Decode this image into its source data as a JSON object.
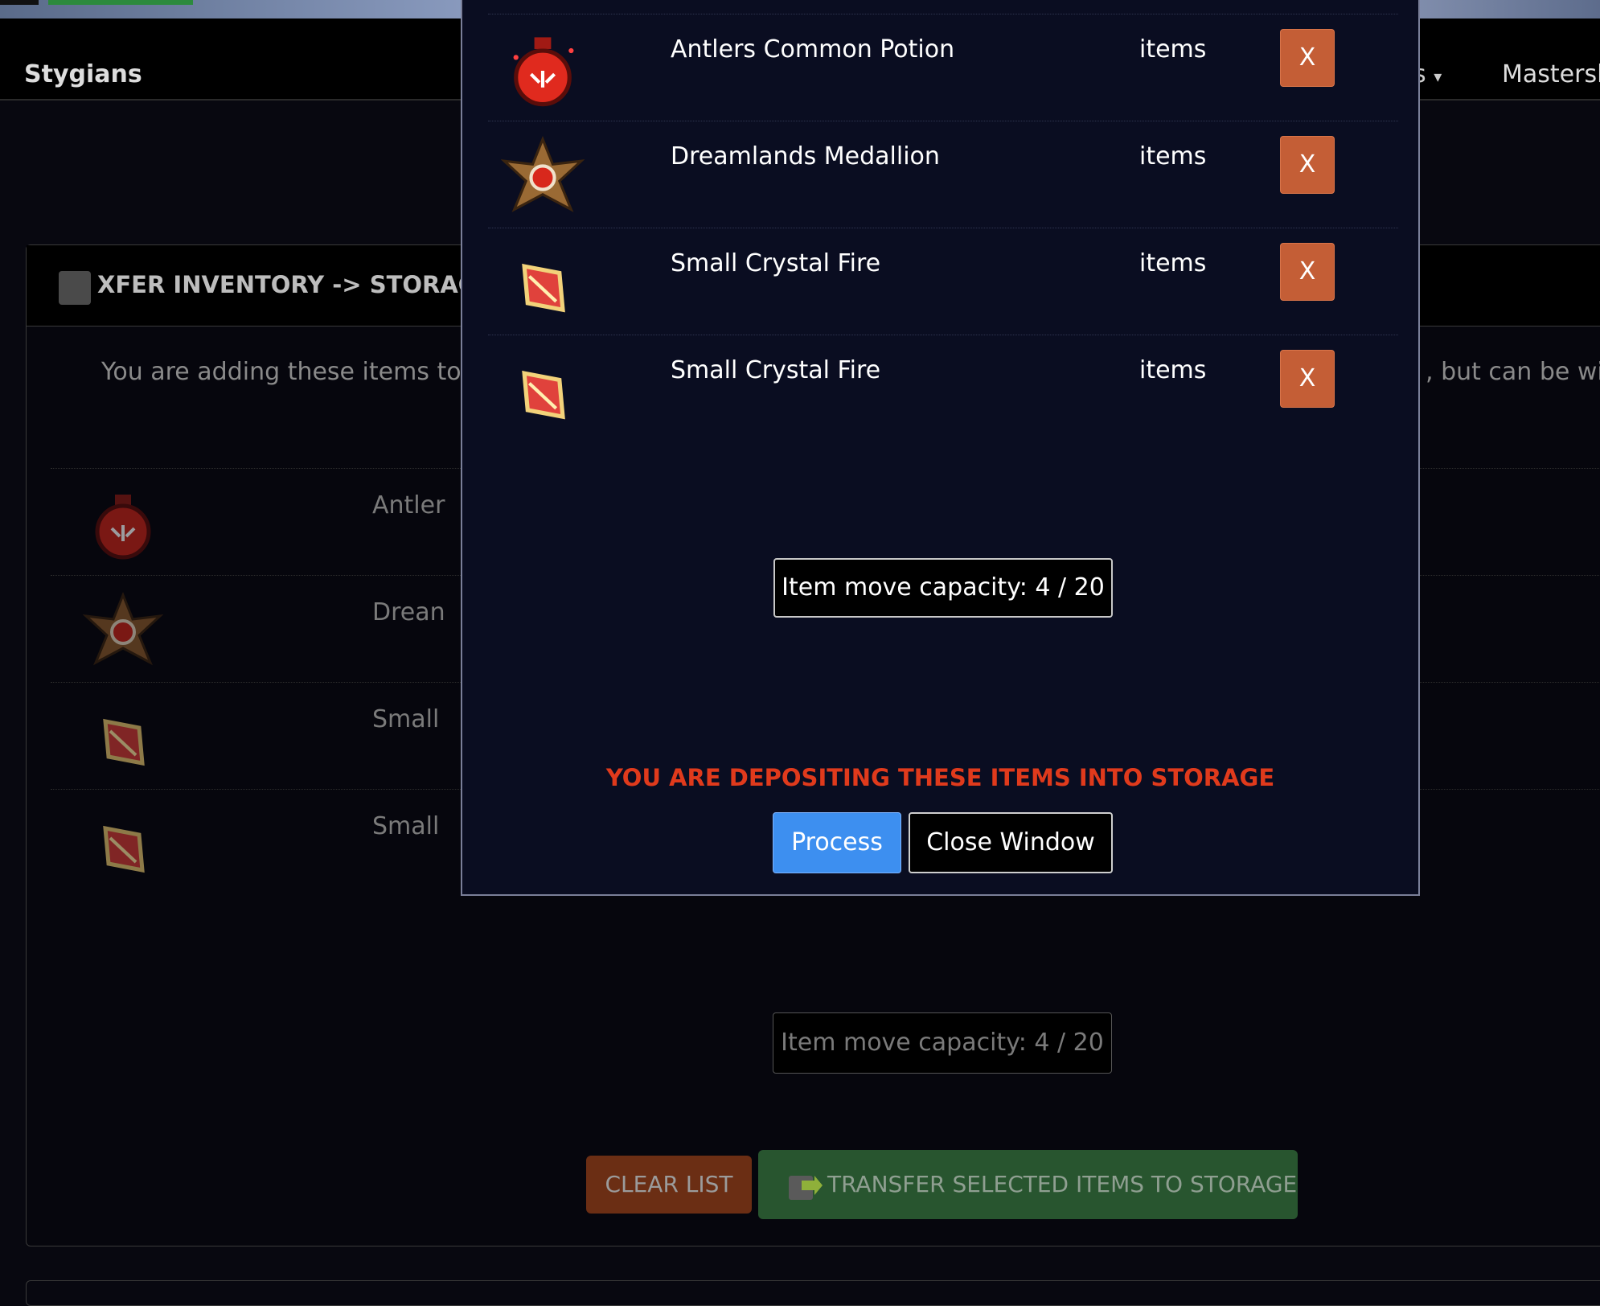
{
  "navbar": {
    "brand": "Stygians",
    "partial_item": "s",
    "caret": "▾",
    "right_item": "Mastersli"
  },
  "panel": {
    "title": "XFER INVENTORY -> STORAGE:",
    "intro_left": "You are adding these items to yo",
    "intro_right": ", but can be with",
    "rows": [
      {
        "name": "Antler",
        "icon": "potion-icon"
      },
      {
        "name": "Drean",
        "icon": "medallion-icon"
      },
      {
        "name": "Small",
        "icon": "crystal-icon"
      },
      {
        "name": "Small",
        "icon": "crystal-icon"
      }
    ],
    "capacity": "Item move capacity: 4 / 20",
    "clear_label": "CLEAR LIST",
    "transfer_label": "TRANSFER SELECTED ITEMS TO STORAGE"
  },
  "modal": {
    "items": [
      {
        "name": "Antlers Common Potion",
        "qty": "items",
        "remove": "X",
        "icon": "potion-icon"
      },
      {
        "name": "Dreamlands Medallion",
        "qty": "items",
        "remove": "X",
        "icon": "medallion-icon"
      },
      {
        "name": "Small Crystal Fire",
        "qty": "items",
        "remove": "X",
        "icon": "crystal-icon"
      },
      {
        "name": "Small Crystal Fire",
        "qty": "items",
        "remove": "X",
        "icon": "crystal-icon"
      }
    ],
    "capacity": "Item move capacity: 4 / 20",
    "warning": "YOU ARE DEPOSITING THESE ITEMS INTO STORAGE",
    "process_label": "Process",
    "close_label": "Close Window"
  },
  "colors": {
    "remove_button": "#c45e36",
    "process_button": "#3d8ff0",
    "warning_text": "#e03a1c",
    "transfer_button": "#28552f",
    "clear_button": "#6b2e14"
  }
}
